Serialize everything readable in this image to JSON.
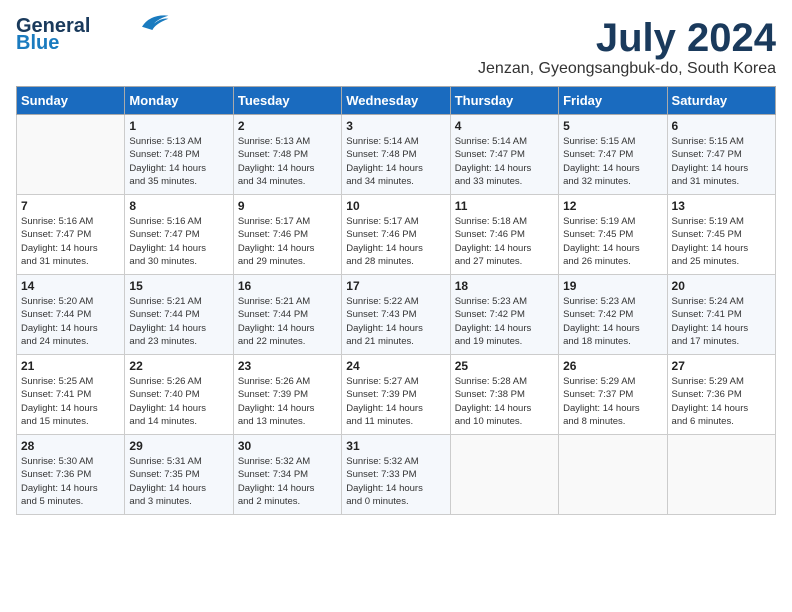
{
  "header": {
    "logo_line1": "General",
    "logo_line2": "Blue",
    "title": "July 2024",
    "subtitle": "Jenzan, Gyeongsangbuk-do, South Korea"
  },
  "days_of_week": [
    "Sunday",
    "Monday",
    "Tuesday",
    "Wednesday",
    "Thursday",
    "Friday",
    "Saturday"
  ],
  "weeks": [
    [
      {
        "num": "",
        "info": ""
      },
      {
        "num": "1",
        "info": "Sunrise: 5:13 AM\nSunset: 7:48 PM\nDaylight: 14 hours\nand 35 minutes."
      },
      {
        "num": "2",
        "info": "Sunrise: 5:13 AM\nSunset: 7:48 PM\nDaylight: 14 hours\nand 34 minutes."
      },
      {
        "num": "3",
        "info": "Sunrise: 5:14 AM\nSunset: 7:48 PM\nDaylight: 14 hours\nand 34 minutes."
      },
      {
        "num": "4",
        "info": "Sunrise: 5:14 AM\nSunset: 7:47 PM\nDaylight: 14 hours\nand 33 minutes."
      },
      {
        "num": "5",
        "info": "Sunrise: 5:15 AM\nSunset: 7:47 PM\nDaylight: 14 hours\nand 32 minutes."
      },
      {
        "num": "6",
        "info": "Sunrise: 5:15 AM\nSunset: 7:47 PM\nDaylight: 14 hours\nand 31 minutes."
      }
    ],
    [
      {
        "num": "7",
        "info": "Sunrise: 5:16 AM\nSunset: 7:47 PM\nDaylight: 14 hours\nand 31 minutes."
      },
      {
        "num": "8",
        "info": "Sunrise: 5:16 AM\nSunset: 7:47 PM\nDaylight: 14 hours\nand 30 minutes."
      },
      {
        "num": "9",
        "info": "Sunrise: 5:17 AM\nSunset: 7:46 PM\nDaylight: 14 hours\nand 29 minutes."
      },
      {
        "num": "10",
        "info": "Sunrise: 5:17 AM\nSunset: 7:46 PM\nDaylight: 14 hours\nand 28 minutes."
      },
      {
        "num": "11",
        "info": "Sunrise: 5:18 AM\nSunset: 7:46 PM\nDaylight: 14 hours\nand 27 minutes."
      },
      {
        "num": "12",
        "info": "Sunrise: 5:19 AM\nSunset: 7:45 PM\nDaylight: 14 hours\nand 26 minutes."
      },
      {
        "num": "13",
        "info": "Sunrise: 5:19 AM\nSunset: 7:45 PM\nDaylight: 14 hours\nand 25 minutes."
      }
    ],
    [
      {
        "num": "14",
        "info": "Sunrise: 5:20 AM\nSunset: 7:44 PM\nDaylight: 14 hours\nand 24 minutes."
      },
      {
        "num": "15",
        "info": "Sunrise: 5:21 AM\nSunset: 7:44 PM\nDaylight: 14 hours\nand 23 minutes."
      },
      {
        "num": "16",
        "info": "Sunrise: 5:21 AM\nSunset: 7:44 PM\nDaylight: 14 hours\nand 22 minutes."
      },
      {
        "num": "17",
        "info": "Sunrise: 5:22 AM\nSunset: 7:43 PM\nDaylight: 14 hours\nand 21 minutes."
      },
      {
        "num": "18",
        "info": "Sunrise: 5:23 AM\nSunset: 7:42 PM\nDaylight: 14 hours\nand 19 minutes."
      },
      {
        "num": "19",
        "info": "Sunrise: 5:23 AM\nSunset: 7:42 PM\nDaylight: 14 hours\nand 18 minutes."
      },
      {
        "num": "20",
        "info": "Sunrise: 5:24 AM\nSunset: 7:41 PM\nDaylight: 14 hours\nand 17 minutes."
      }
    ],
    [
      {
        "num": "21",
        "info": "Sunrise: 5:25 AM\nSunset: 7:41 PM\nDaylight: 14 hours\nand 15 minutes."
      },
      {
        "num": "22",
        "info": "Sunrise: 5:26 AM\nSunset: 7:40 PM\nDaylight: 14 hours\nand 14 minutes."
      },
      {
        "num": "23",
        "info": "Sunrise: 5:26 AM\nSunset: 7:39 PM\nDaylight: 14 hours\nand 13 minutes."
      },
      {
        "num": "24",
        "info": "Sunrise: 5:27 AM\nSunset: 7:39 PM\nDaylight: 14 hours\nand 11 minutes."
      },
      {
        "num": "25",
        "info": "Sunrise: 5:28 AM\nSunset: 7:38 PM\nDaylight: 14 hours\nand 10 minutes."
      },
      {
        "num": "26",
        "info": "Sunrise: 5:29 AM\nSunset: 7:37 PM\nDaylight: 14 hours\nand 8 minutes."
      },
      {
        "num": "27",
        "info": "Sunrise: 5:29 AM\nSunset: 7:36 PM\nDaylight: 14 hours\nand 6 minutes."
      }
    ],
    [
      {
        "num": "28",
        "info": "Sunrise: 5:30 AM\nSunset: 7:36 PM\nDaylight: 14 hours\nand 5 minutes."
      },
      {
        "num": "29",
        "info": "Sunrise: 5:31 AM\nSunset: 7:35 PM\nDaylight: 14 hours\nand 3 minutes."
      },
      {
        "num": "30",
        "info": "Sunrise: 5:32 AM\nSunset: 7:34 PM\nDaylight: 14 hours\nand 2 minutes."
      },
      {
        "num": "31",
        "info": "Sunrise: 5:32 AM\nSunset: 7:33 PM\nDaylight: 14 hours\nand 0 minutes."
      },
      {
        "num": "",
        "info": ""
      },
      {
        "num": "",
        "info": ""
      },
      {
        "num": "",
        "info": ""
      }
    ]
  ]
}
